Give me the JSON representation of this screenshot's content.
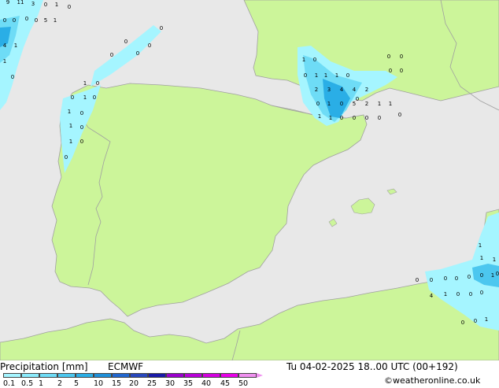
{
  "title": "Precipitation [mm]",
  "model": "ECMWF",
  "valid_time": "Tu 04-02-2025 18..00 UTC (00+192)",
  "credit": "©weatheronline.co.uk",
  "legend": {
    "levels": [
      "0.1",
      "0.5",
      "1",
      "2",
      "5",
      "10",
      "15",
      "20",
      "25",
      "30",
      "35",
      "40",
      "45",
      "50"
    ],
    "colors": [
      "#a5f5ff",
      "#8bebfc",
      "#6edcf6",
      "#4cc7ef",
      "#2aaee6",
      "#1e8fd9",
      "#2166cf",
      "#2847bd",
      "#1a1aa8",
      "#9a00cc",
      "#b800d8",
      "#d400e0",
      "#e800e8",
      "#f090f0"
    ]
  },
  "colors": {
    "sea": "#e8e8e8",
    "land": "#ccf59a",
    "border": "#a0a0a0"
  },
  "point_values": [
    {
      "v": "9"
    },
    {
      "v": "11"
    },
    {
      "v": "3"
    },
    {
      "v": "0"
    },
    {
      "v": "1"
    },
    {
      "v": "0"
    },
    {
      "v": "0"
    },
    {
      "v": "0"
    },
    {
      "v": "0"
    },
    {
      "v": "0"
    },
    {
      "v": "5"
    },
    {
      "v": "1"
    },
    {
      "v": "4"
    },
    {
      "v": "1"
    },
    {
      "v": "1"
    },
    {
      "v": "0"
    },
    {
      "v": "0"
    },
    {
      "v": "0"
    },
    {
      "v": "0"
    },
    {
      "v": "0"
    },
    {
      "v": "0"
    },
    {
      "v": "1"
    },
    {
      "v": "0"
    },
    {
      "v": "0"
    },
    {
      "v": "1"
    },
    {
      "v": "0"
    },
    {
      "v": "1"
    },
    {
      "v": "0"
    },
    {
      "v": "1"
    },
    {
      "v": "0"
    },
    {
      "v": "1"
    },
    {
      "v": "0"
    },
    {
      "v": "0"
    },
    {
      "v": "1"
    },
    {
      "v": "0"
    },
    {
      "v": "0"
    },
    {
      "v": "0"
    },
    {
      "v": "0"
    },
    {
      "v": "0"
    },
    {
      "v": "0"
    },
    {
      "v": "1"
    },
    {
      "v": "1"
    },
    {
      "v": "1"
    },
    {
      "v": "0"
    },
    {
      "v": "2"
    },
    {
      "v": "3"
    },
    {
      "v": "4"
    },
    {
      "v": "4"
    },
    {
      "v": "2"
    },
    {
      "v": "0"
    },
    {
      "v": "1"
    },
    {
      "v": "0"
    },
    {
      "v": "5"
    },
    {
      "v": "2"
    },
    {
      "v": "1"
    },
    {
      "v": "1"
    },
    {
      "v": "1"
    },
    {
      "v": "1"
    },
    {
      "v": "0"
    },
    {
      "v": "0"
    },
    {
      "v": "0"
    },
    {
      "v": "0"
    },
    {
      "v": "0"
    },
    {
      "v": "0"
    },
    {
      "v": "0"
    },
    {
      "v": "0"
    },
    {
      "v": "0"
    },
    {
      "v": "0"
    },
    {
      "v": "0"
    },
    {
      "v": "0"
    },
    {
      "v": "1"
    },
    {
      "v": "1"
    },
    {
      "v": "1"
    },
    {
      "v": "1"
    },
    {
      "v": "0"
    },
    {
      "v": "4"
    },
    {
      "v": "1"
    },
    {
      "v": "0"
    },
    {
      "v": "0"
    },
    {
      "v": "0"
    },
    {
      "v": "0"
    },
    {
      "v": "0"
    },
    {
      "v": "1"
    },
    {
      "v": "1"
    }
  ]
}
